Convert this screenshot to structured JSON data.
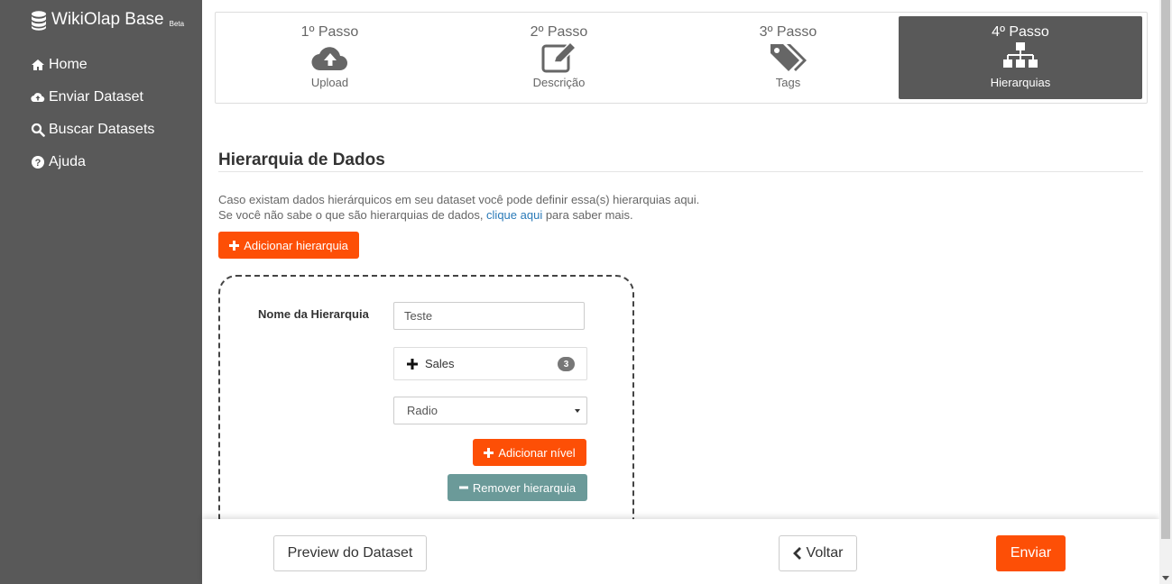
{
  "app": {
    "name": "WikiOlap Base",
    "beta": "Beta"
  },
  "sidebar": {
    "items": [
      {
        "label": "Home",
        "icon": "home-icon"
      },
      {
        "label": "Enviar Dataset",
        "icon": "cloud-upload-icon"
      },
      {
        "label": "Buscar Datasets",
        "icon": "search-icon"
      },
      {
        "label": "Ajuda",
        "icon": "question-circle-icon"
      }
    ]
  },
  "steps": [
    {
      "title": "1º Passo",
      "label": "Upload",
      "icon": "cloud-upload-icon",
      "active": false
    },
    {
      "title": "2º Passo",
      "label": "Descrição",
      "icon": "edit-icon",
      "active": false
    },
    {
      "title": "3º Passo",
      "label": "Tags",
      "icon": "tags-icon",
      "active": false
    },
    {
      "title": "4º Passo",
      "label": "Hierarquias",
      "icon": "sitemap-icon",
      "active": true
    }
  ],
  "section": {
    "title": "Hierarquia de Dados",
    "desc_line1": "Caso existam dados hierárquicos em seu dataset você pode definir essa(s) hierarquias aqui.",
    "desc_line2_pre": "Se você não sabe o que são hierarquias de dados, ",
    "desc_link": "clique aqui",
    "desc_line2_post": " para saber mais.",
    "add_hierarchy_label": "Adicionar hierarquia"
  },
  "hierarchy": {
    "name_label": "Nome da Hierarquia",
    "name_value": "Teste",
    "level_name": "Sales",
    "level_count": "3",
    "select_value": "Radio",
    "add_level_label": "Adicionar nível",
    "remove_label": "Remover hierarquia"
  },
  "footer": {
    "preview_label": "Preview do Dataset",
    "back_label": "Voltar",
    "submit_label": "Enviar"
  },
  "colors": {
    "sidebar": "#595959",
    "accent": "#fd4f06",
    "teal": "#6b9a99",
    "link": "#2a7ab8"
  }
}
